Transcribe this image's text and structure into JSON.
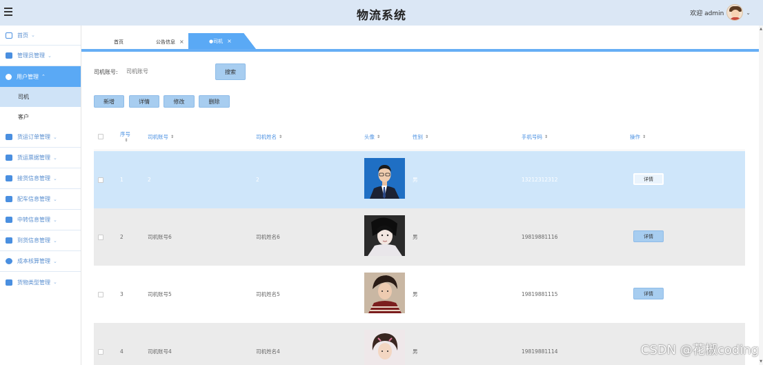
{
  "header": {
    "title": "物流系统",
    "welcome": "欢迎 admin"
  },
  "sidebar": {
    "items": [
      {
        "label": "首页",
        "icon": "home-icon"
      },
      {
        "label": "管理员管理",
        "icon": "admin-icon"
      },
      {
        "label": "用户管理",
        "icon": "user-icon",
        "expanded": true,
        "children": [
          "司机",
          "客户"
        ],
        "selected_child": "司机"
      },
      {
        "label": "货运订单管理",
        "icon": "order-icon"
      },
      {
        "label": "货运票据管理",
        "icon": "ticket-icon"
      },
      {
        "label": "接货信息管理",
        "icon": "receive-icon"
      },
      {
        "label": "配车信息管理",
        "icon": "vehicle-icon"
      },
      {
        "label": "中转信息管理",
        "icon": "transfer-icon"
      },
      {
        "label": "到货信息管理",
        "icon": "arrival-icon"
      },
      {
        "label": "成本核算管理",
        "icon": "cost-icon"
      },
      {
        "label": "货物类型管理",
        "icon": "goods-icon"
      }
    ]
  },
  "tabs": [
    {
      "label": "首页",
      "closable": false
    },
    {
      "label": "公告信息",
      "closable": true
    },
    {
      "label": "●司机",
      "closable": true,
      "active": true
    }
  ],
  "search": {
    "label": "司机账号:",
    "placeholder": "司机账号",
    "button": "搜索"
  },
  "actions": {
    "add": "新增",
    "detail": "详情",
    "edit": "修改",
    "delete": "删除"
  },
  "table": {
    "headers": {
      "index_top": "序号",
      "account": "司机账号",
      "name": "司机姓名",
      "avatar": "头像",
      "gender": "性别",
      "phone": "手机号码",
      "ops": "操作"
    },
    "rows": [
      {
        "index": "1",
        "account": "2",
        "name": "2",
        "gender": "男",
        "phone": "13212312312",
        "btn": "详情"
      },
      {
        "index": "2",
        "account": "司机账号6",
        "name": "司机姓名6",
        "gender": "男",
        "phone": "19819881116",
        "btn": "详情"
      },
      {
        "index": "3",
        "account": "司机账号5",
        "name": "司机姓名5",
        "gender": "男",
        "phone": "19819881115",
        "btn": "详情"
      },
      {
        "index": "4",
        "account": "司机账号4",
        "name": "司机姓名4",
        "gender": "男",
        "phone": "19819881114",
        "btn": "详情"
      }
    ]
  },
  "watermark": "CSDN @花椒coding",
  "colors": {
    "accent": "#5aa9f5",
    "header_bg": "#dbe7f5",
    "button_bg": "#a7cdf0",
    "selected_row": "#cfe6fa"
  }
}
